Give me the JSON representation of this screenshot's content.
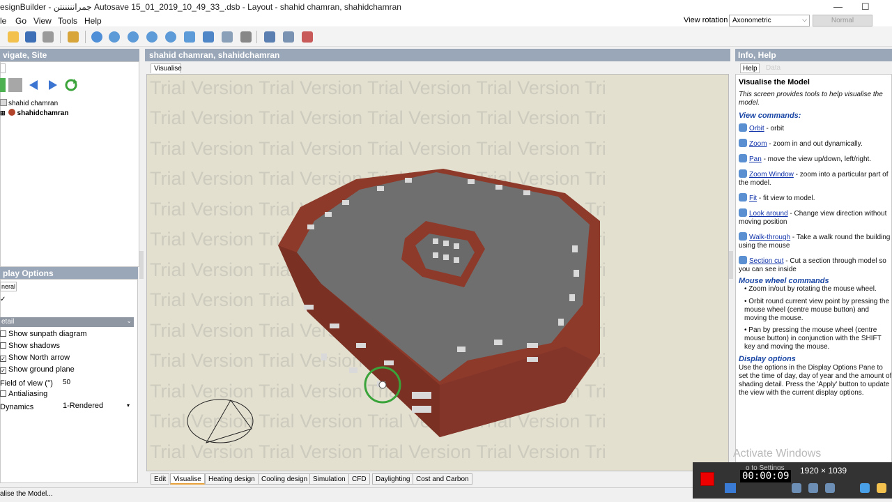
{
  "titlebar": {
    "title": "esignBuilder - جمرانننننتن Autosave 15_01_2019_10_49_33_.dsb - Layout - shahid chamran, shahidchamran",
    "minimize_icon": "—",
    "maximize_icon": "☐",
    "close_icon": "✕"
  },
  "menubar": {
    "items": [
      "le",
      "Go",
      "View",
      "Tools",
      "Help"
    ]
  },
  "view_rotation": {
    "label": "View rotation",
    "value": "Axonometric",
    "normal_button": "Normal"
  },
  "left_panel": {
    "title": "vigate, Site",
    "tree": {
      "site": "shahid chamran",
      "building": "shahidchamran"
    }
  },
  "display_options": {
    "title": "play Options",
    "tab": "neral",
    "section": "etail",
    "options": [
      {
        "label": "Show sunpath diagram",
        "checked": false
      },
      {
        "label": "Show shadows",
        "checked": false
      },
      {
        "label": "Show North arrow",
        "checked": true
      },
      {
        "label": "Show ground plane",
        "checked": true
      }
    ],
    "fov_label": "Field of view (°)",
    "fov_value": "50",
    "antialiasing_label": "Antialiasing",
    "dynamics_label": "Dynamics",
    "dynamics_value": "1-Rendered"
  },
  "center": {
    "title": "shahid chamran, shahidchamran",
    "tab": "Visualise",
    "watermark": "Trial Version Trial Version Trial Version Trial Version Tri",
    "bottom_tabs": [
      "Edit",
      "Visualise",
      "Heating design",
      "Cooling design",
      "Simulation",
      "CFD",
      "Daylighting",
      "Cost and Carbon"
    ]
  },
  "right_panel": {
    "title": "Info, Help",
    "tab_help": "Help",
    "tab_data": "Data",
    "heading": "Visualise the Model",
    "intro": "This screen provides tools to help visualise the model.",
    "view_commands_title": "View commands:",
    "commands": [
      {
        "name": "Orbit",
        "desc": " - orbit"
      },
      {
        "name": "Zoom",
        "desc": " - zoom in and out dynamically."
      },
      {
        "name": "Pan",
        "desc": " - move the view up/down, left/right."
      },
      {
        "name": "Zoom Window",
        "desc": " - zoom into a particular part of the model."
      },
      {
        "name": "Fit",
        "desc": " - fit view to model."
      },
      {
        "name": "Look around",
        "desc": " - Change view direction without moving position"
      },
      {
        "name": "Walk-through",
        "desc": " - Take a walk round the building using the mouse"
      },
      {
        "name": "Section cut",
        "desc": " - Cut a section through model so you can see inside"
      }
    ],
    "mouse_wheel_title": "Mouse wheel commands",
    "mouse_wheel": [
      "Zoom in/out by rotating the mouse wheel.",
      "Orbit round current view point by pressing the mouse wheel (centre mouse button) and moving the mouse.",
      "Pan by pressing the mouse wheel (centre mouse button) in conjunction with the SHIFT key and moving the mouse."
    ],
    "display_options_title": "Display options",
    "display_options_text": "Use the options in the Display Options Pane to set the time of day, day of year and the amount of shading detail. Press the 'Apply' button to update the view with the current display options."
  },
  "status": {
    "text": "alise the Model..."
  },
  "overlay": {
    "activate_windows": "Activate Windows",
    "go_settings": "o to Settings",
    "recorder_time": "00:00:09",
    "resolution": "1920 × 1039"
  },
  "colors": {
    "panel_header": "#9aa7b8",
    "viewport_bg": "#e3e0d0",
    "brick": "#8e3a2a",
    "roof": "#6f6f6f"
  }
}
